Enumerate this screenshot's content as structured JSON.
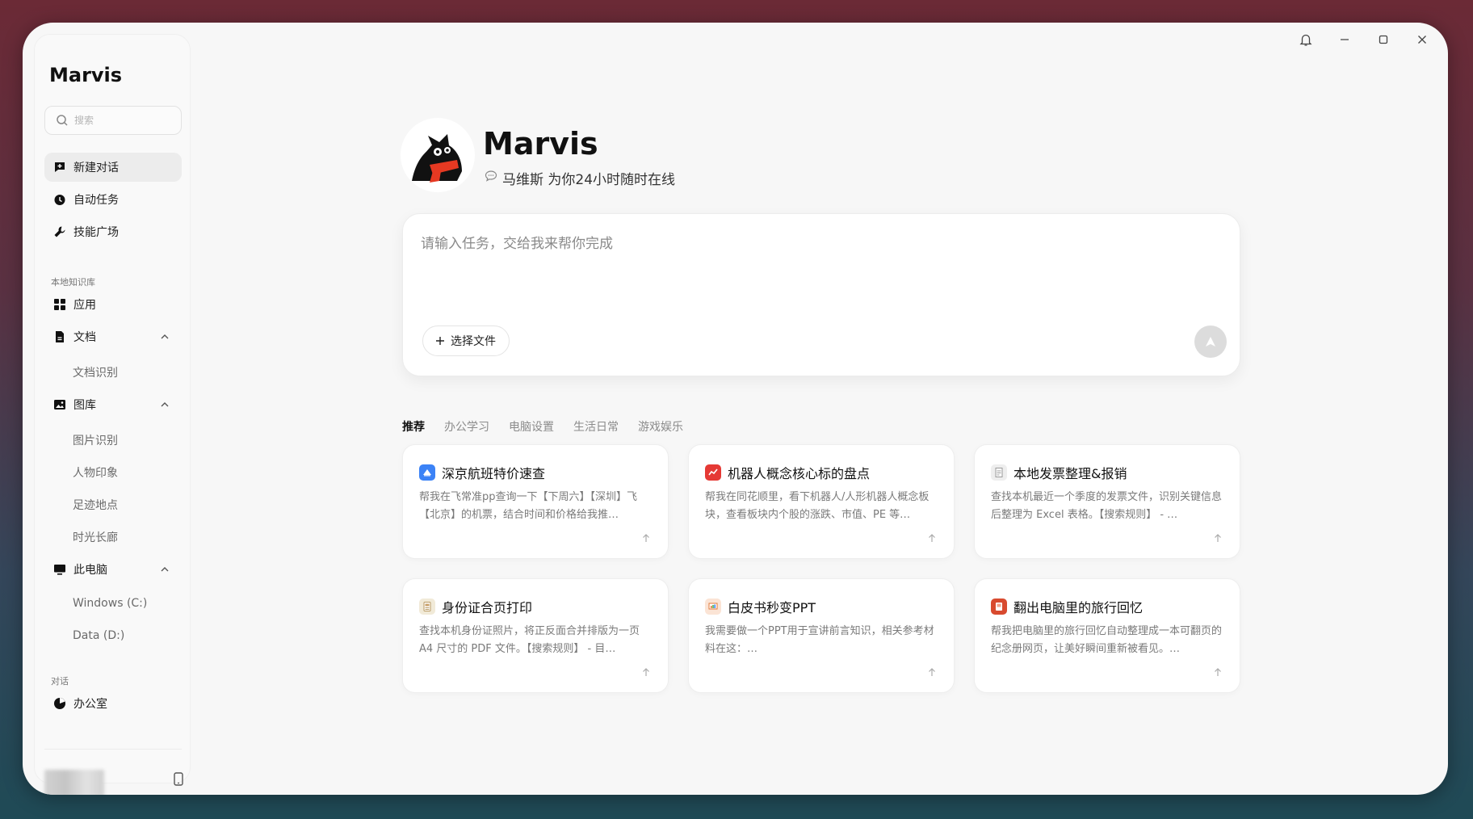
{
  "app": {
    "title": "Marvis"
  },
  "search": {
    "placeholder": "搜索"
  },
  "sidebar": {
    "nav": [
      {
        "label": "新建对话",
        "icon": "new-chat-icon"
      },
      {
        "label": "自动任务",
        "icon": "clock-icon"
      },
      {
        "label": "技能广场",
        "icon": "wrench-icon"
      }
    ],
    "section_knowledge": "本地知识库",
    "knowledge": {
      "apps": "应用",
      "docs": "文档",
      "docs_children": [
        "文档识别"
      ],
      "gallery": "图库",
      "gallery_children": [
        "图片识别",
        "人物印象",
        "足迹地点",
        "时光长廊"
      ],
      "pc": "此电脑",
      "pc_children": [
        "Windows (C:)",
        "Data (D:)"
      ]
    },
    "section_chats": "对话",
    "chats": [
      {
        "label": "办公室",
        "icon": "pie-icon"
      }
    ]
  },
  "hero": {
    "brand": "Marvis",
    "tagline": "马维斯 为你24小时随时在线"
  },
  "composer": {
    "placeholder": "请输入任务，交给我来帮你完成",
    "file_button": "选择文件"
  },
  "tabs": [
    "推荐",
    "办公学习",
    "电脑设置",
    "生活日常",
    "游戏娱乐"
  ],
  "cards": [
    {
      "title": "深京航班特价速查",
      "desc": "帮我在飞常准pp查询一下【下周六】【深圳】飞【北京】的机票，结合时间和价格给我推…",
      "icon": "plane-icon",
      "color": "#3b82f6"
    },
    {
      "title": "机器人概念核心标的盘点",
      "desc": "帮我在同花顺里，看下机器人/人形机器人概念板块，查看板块内个股的涨跌、市值、PE 等…",
      "icon": "stock-icon",
      "color": "#e53935"
    },
    {
      "title": "本地发票整理&报销",
      "desc": "查找本机最近一个季度的发票文件，识别关键信息后整理为 Excel 表格。【搜索规则】 - …",
      "icon": "invoice-icon",
      "color": "#9e9e9e"
    },
    {
      "title": "身份证合页打印",
      "desc": "查找本机身份证照片，将正反面合并排版为一页 A4 尺寸的 PDF 文件。【搜索规则】 - 目…",
      "icon": "id-card-icon",
      "color": "#c9a26b"
    },
    {
      "title": "白皮书秒变PPT",
      "desc": "我需要做一个PPT用于宣讲前言知识，相关参考材料在这：…",
      "icon": "ppt-icon",
      "color": "#e07a3a"
    },
    {
      "title": "翻出电脑里的旅行回忆",
      "desc": "帮我把电脑里的旅行回忆自动整理成一本可翻页的纪念册网页，让美好瞬间重新被看见。…",
      "icon": "album-icon",
      "color": "#d84a2f"
    }
  ]
}
